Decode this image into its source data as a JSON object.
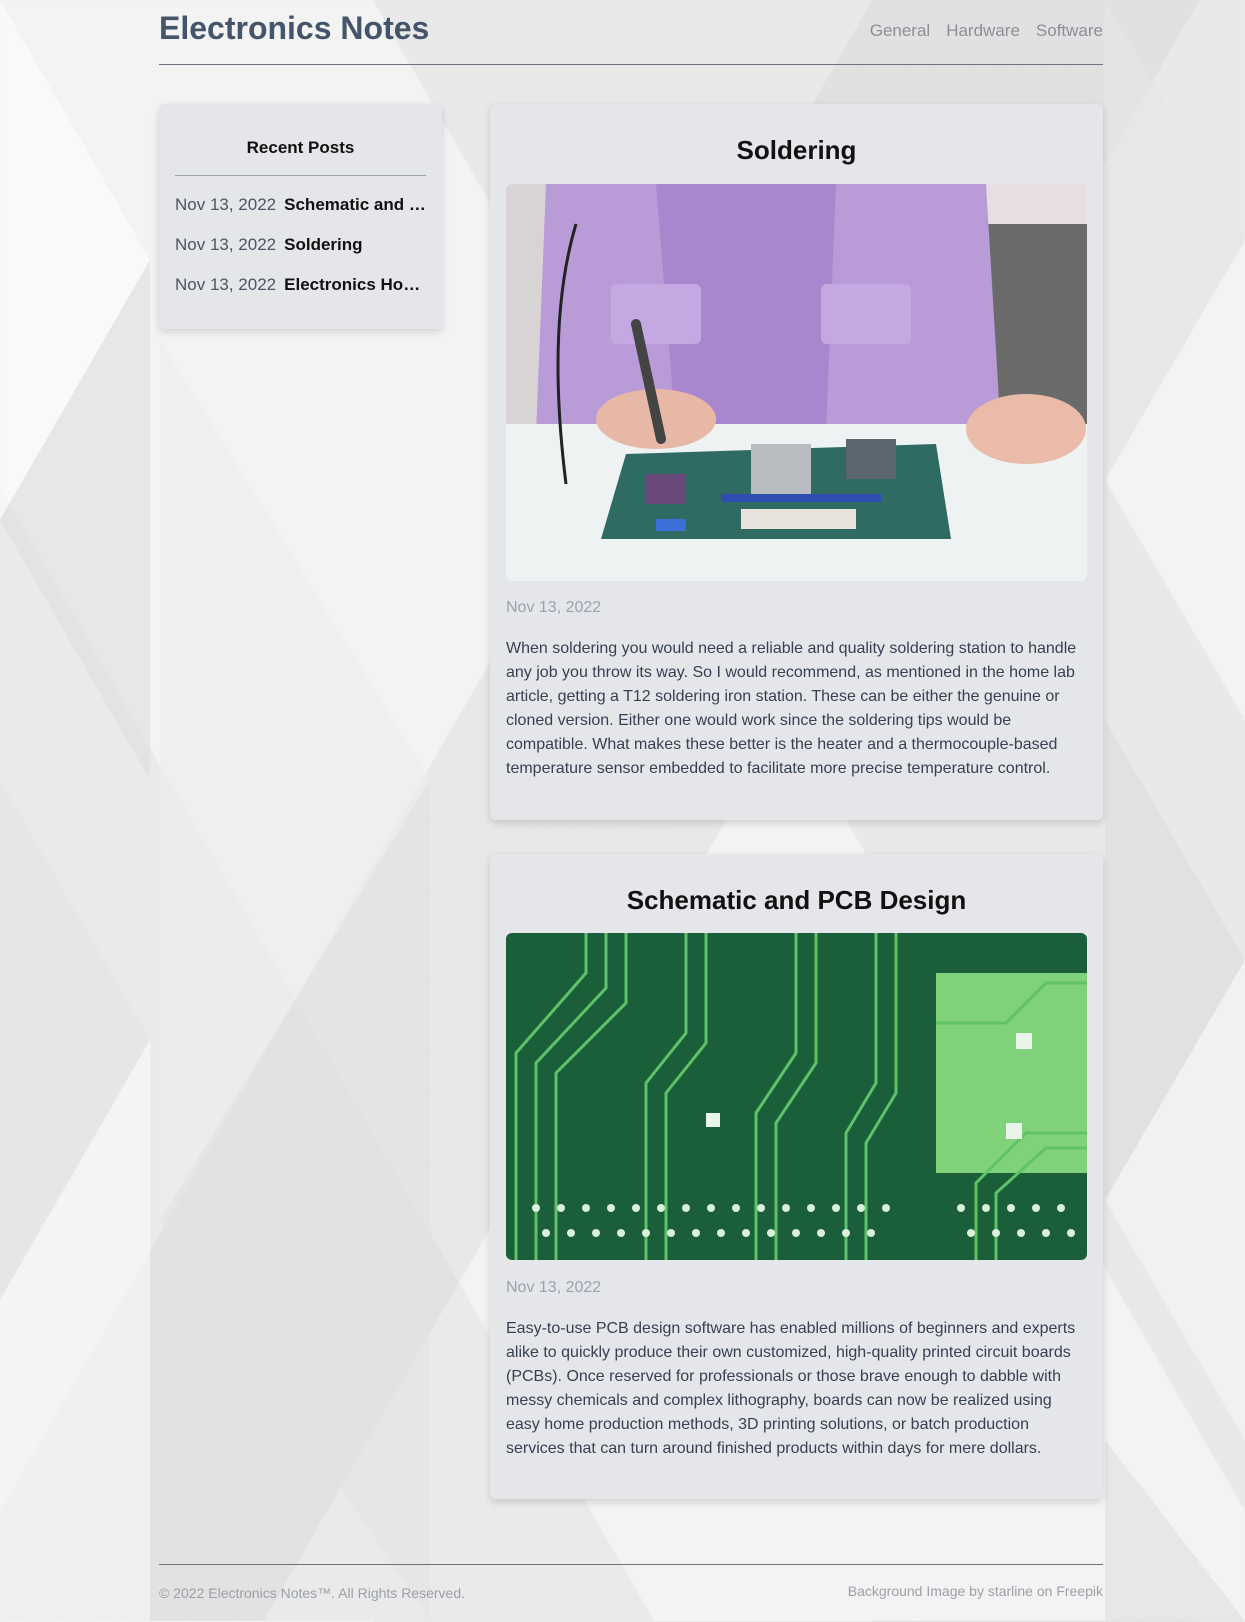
{
  "header": {
    "title": "Electronics Notes",
    "nav": [
      "General",
      "Hardware",
      "Software"
    ]
  },
  "sidebar": {
    "heading": "Recent Posts",
    "posts": [
      {
        "date": "Nov 13, 2022",
        "title": "Schematic and PCB Design"
      },
      {
        "date": "Nov 13, 2022",
        "title": "Soldering"
      },
      {
        "date": "Nov 13, 2022",
        "title": "Electronics Home Lab"
      }
    ]
  },
  "posts": [
    {
      "title": "Soldering",
      "date": "Nov 13, 2022",
      "image": "soldering-photo",
      "body": "When soldering you would need a reliable and quality soldering station to handle any job you throw its way. So I would recommend, as mentioned in the home lab article, getting a T12 soldering iron station. These can be either the genuine or cloned version. Either one would work since the soldering tips would be compatible. What makes these better is the heater and a thermocouple-based temperature sensor embedded to facilitate more precise temperature control."
    },
    {
      "title": "Schematic and PCB Design",
      "date": "Nov 13, 2022",
      "image": "pcb-traces-photo",
      "body": "Easy-to-use PCB design software has enabled millions of beginners and experts alike to quickly produce their own customized, high-quality printed circuit boards (PCBs). Once reserved for professionals or those brave enough to dabble with messy chemicals and complex lithography, boards can now be realized using easy home production methods, 3D printing solutions, or batch production services that can turn around finished products within days for mere dollars."
    }
  ],
  "footer": {
    "copyright": "© 2022 Electronics Notes™. All Rights Reserved.",
    "credit": "Background Image by starline on Freepik"
  },
  "colors": {
    "title": "#44546a",
    "card": "#e4e6ea",
    "muted": "#9aa3b1"
  }
}
